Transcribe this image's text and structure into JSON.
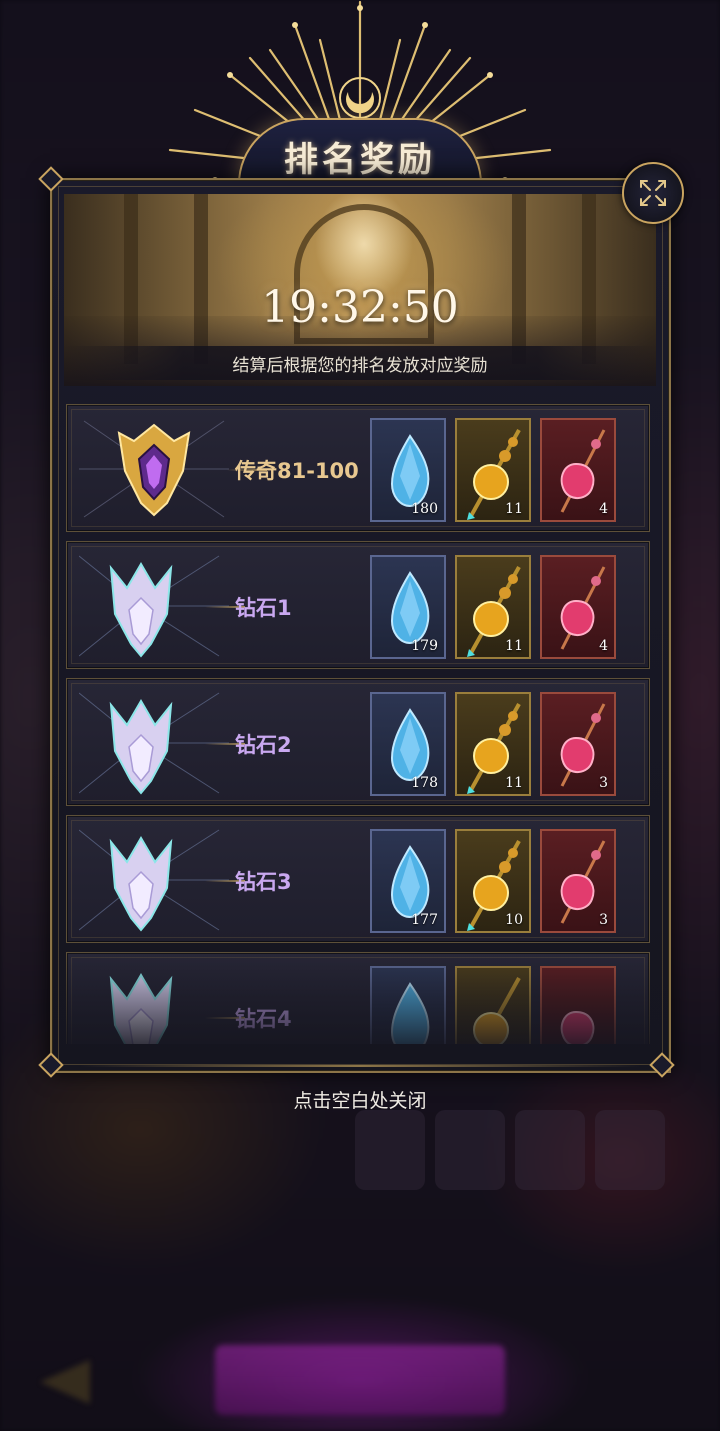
{
  "dialog": {
    "title": "排名奖励",
    "timer": "19:32:50",
    "subtitle": "结算后根据您的排名发放对应奖励",
    "close_hint": "点击空白处关闭"
  },
  "colors": {
    "gold_accent": "#c9a460",
    "legend_text": "#e8c890",
    "diamond_text": "#c9a8f0",
    "panel_bg": "#1a1a2a"
  },
  "rows": [
    {
      "tier": "legend",
      "label": "传奇81-100",
      "items": [
        {
          "icon": "blue-crystal-icon",
          "count": "180"
        },
        {
          "icon": "gold-potion-icon",
          "count": "11"
        },
        {
          "icon": "red-potion-icon",
          "count": "4"
        }
      ]
    },
    {
      "tier": "diamond",
      "label": "钻石1",
      "items": [
        {
          "icon": "blue-crystal-icon",
          "count": "179"
        },
        {
          "icon": "gold-potion-icon",
          "count": "11"
        },
        {
          "icon": "red-potion-icon",
          "count": "4"
        }
      ]
    },
    {
      "tier": "diamond",
      "label": "钻石2",
      "items": [
        {
          "icon": "blue-crystal-icon",
          "count": "178"
        },
        {
          "icon": "gold-potion-icon",
          "count": "11"
        },
        {
          "icon": "red-potion-icon",
          "count": "3"
        }
      ]
    },
    {
      "tier": "diamond",
      "label": "钻石3",
      "items": [
        {
          "icon": "blue-crystal-icon",
          "count": "177"
        },
        {
          "icon": "gold-potion-icon",
          "count": "10"
        },
        {
          "icon": "red-potion-icon",
          "count": "3"
        }
      ]
    },
    {
      "tier": "diamond",
      "label": "钻石4",
      "items": [
        {
          "icon": "blue-crystal-icon",
          "count": ""
        },
        {
          "icon": "gold-potion-icon",
          "count": ""
        },
        {
          "icon": "red-potion-icon",
          "count": ""
        }
      ]
    }
  ]
}
